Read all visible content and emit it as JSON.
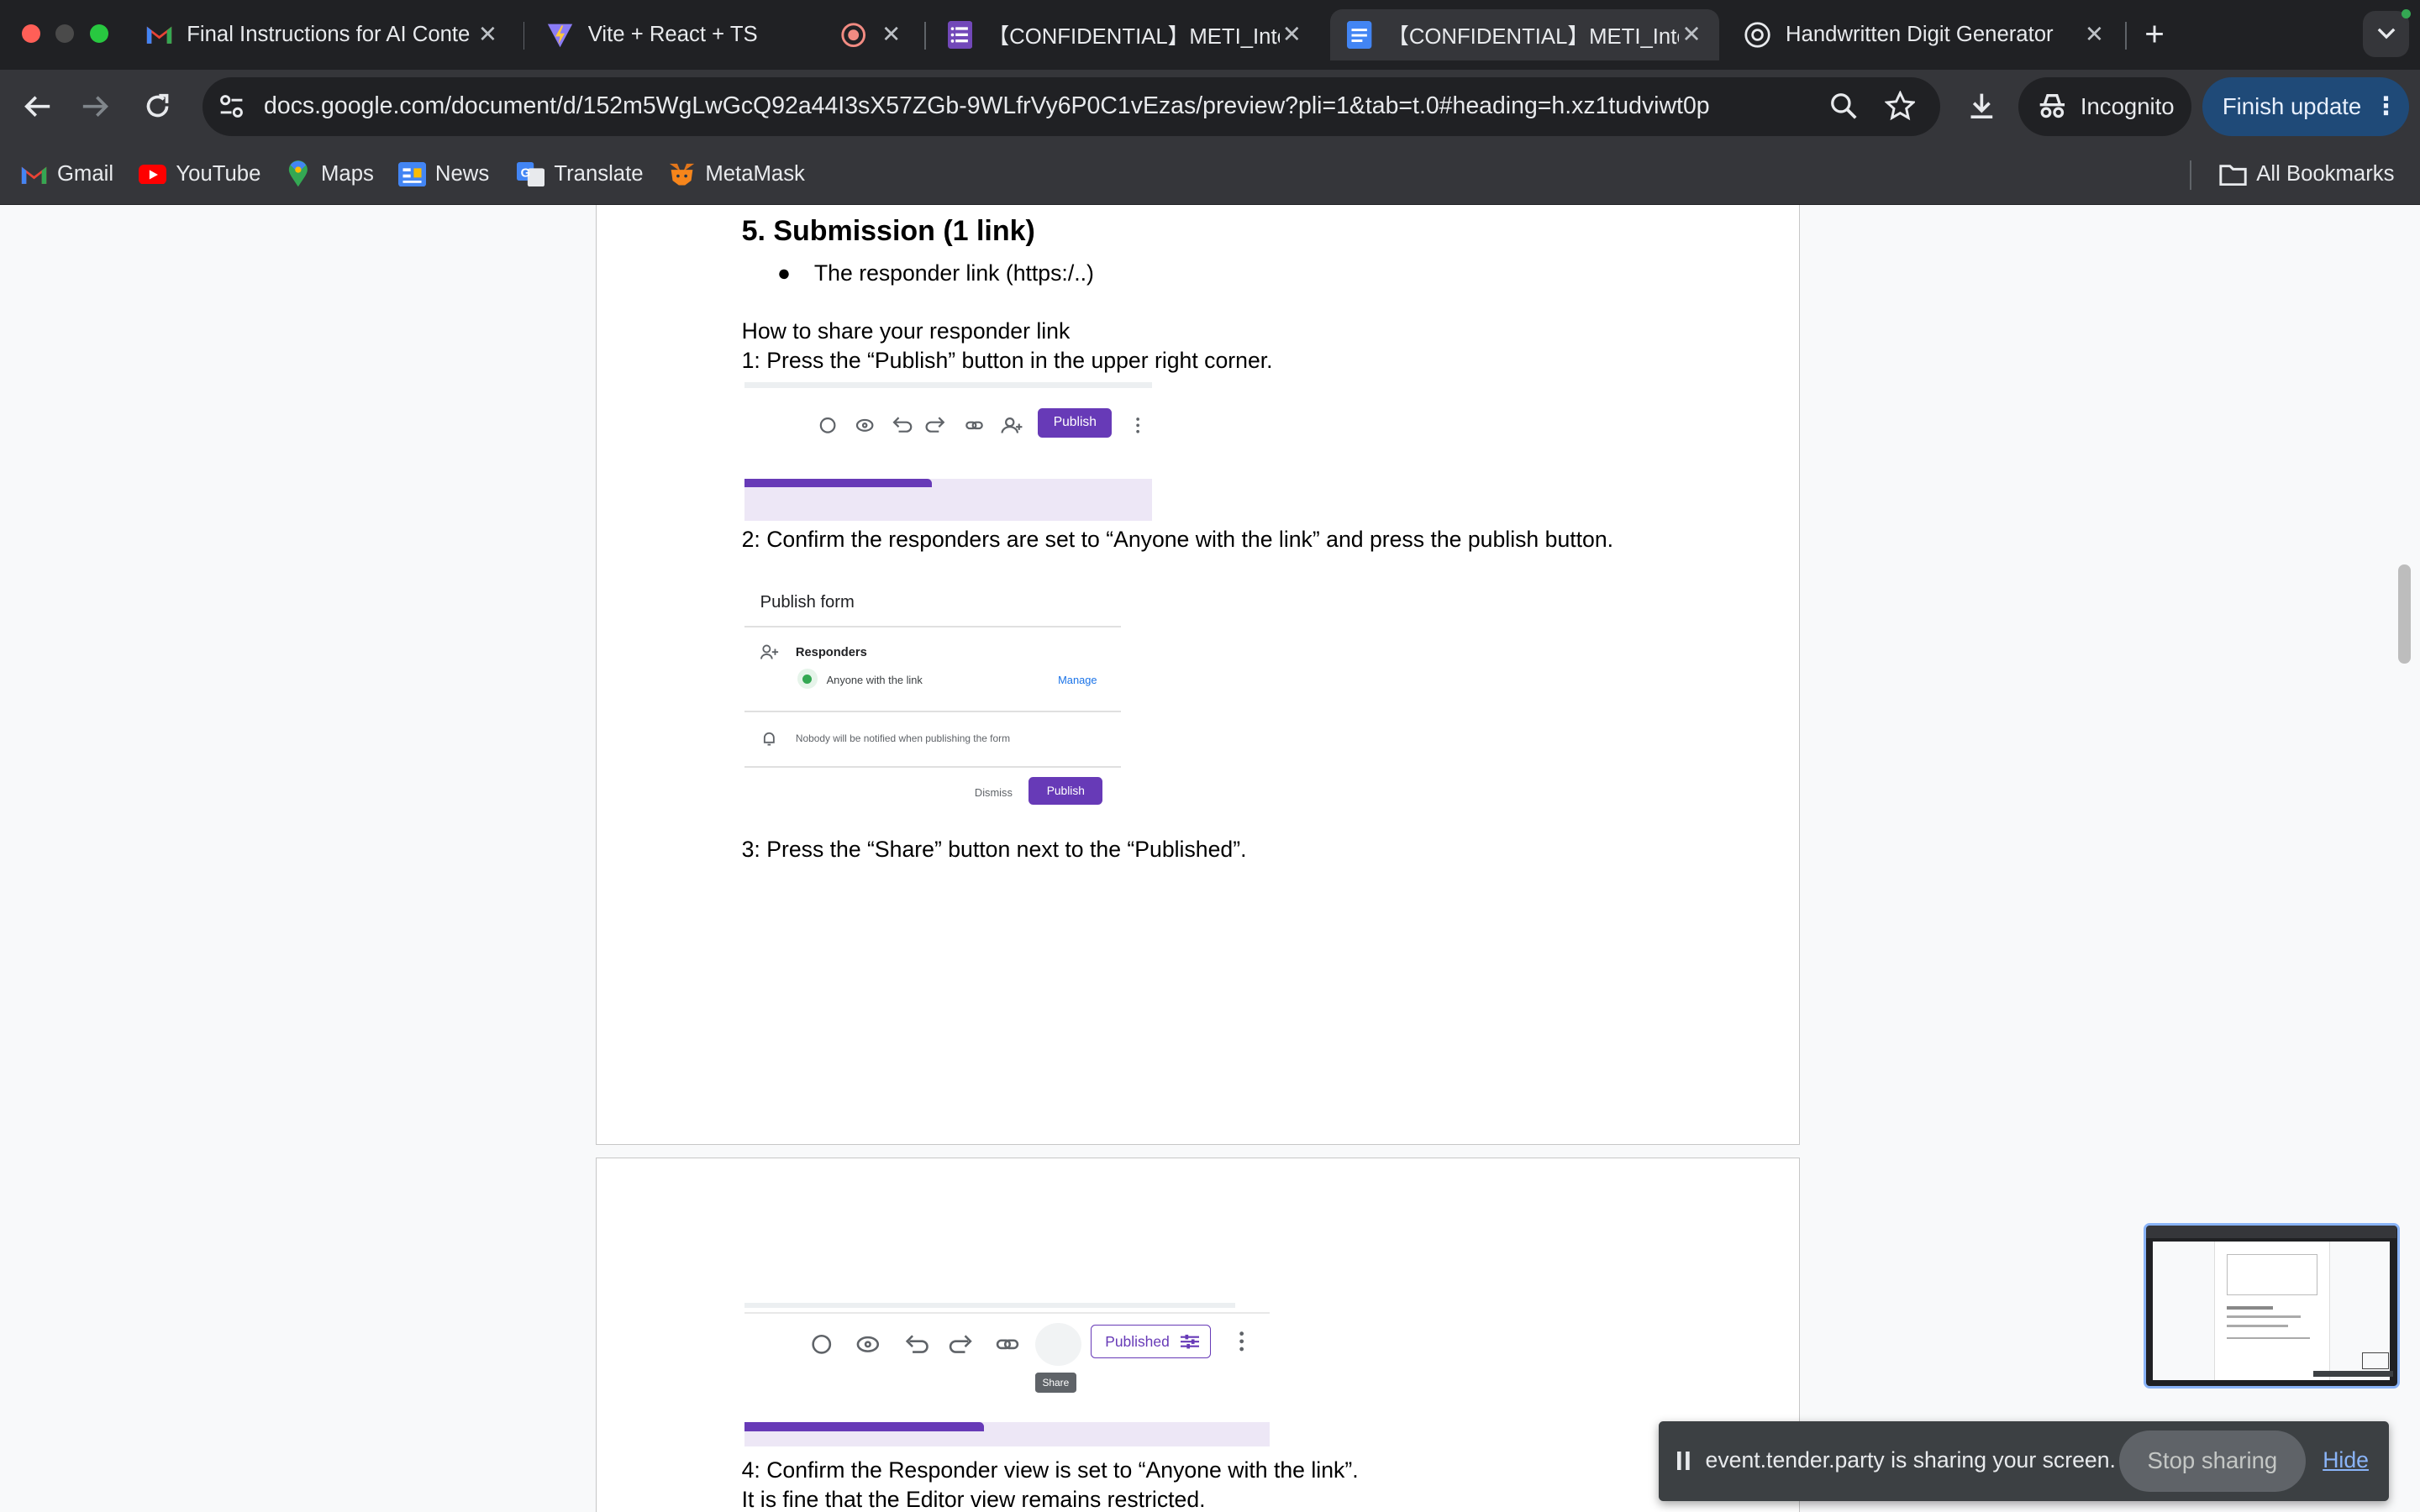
{
  "browser": {
    "tabs": [
      {
        "title": "Final Instructions for AI Conte",
        "favicon": "gmail-icon"
      },
      {
        "title": "Vite + React + TS",
        "favicon": "vite-icon"
      },
      {
        "title": "",
        "favicon": "recording-icon"
      },
      {
        "title": "【CONFIDENTIAL】METI_Inte",
        "favicon": "forms-icon"
      },
      {
        "title": "【CONFIDENTIAL】METI_Inte",
        "favicon": "docs-icon"
      },
      {
        "title": "Handwritten Digit Generator",
        "favicon": "openai-icon"
      }
    ],
    "url": "docs.google.com/document/d/152m5WgLwGcQ92a44I3sX57ZGb-9WLfrVy6P0C1vEzas/preview?pli=1&tab=t.0#heading=h.xz1tudviwt0p",
    "incognito_label": "Incognito",
    "finish_update_label": "Finish update",
    "bookmarks": [
      {
        "label": "Gmail",
        "icon": "gmail-icon"
      },
      {
        "label": "YouTube",
        "icon": "youtube-icon"
      },
      {
        "label": "Maps",
        "icon": "maps-icon"
      },
      {
        "label": "News",
        "icon": "news-icon"
      },
      {
        "label": "Translate",
        "icon": "translate-icon"
      },
      {
        "label": "MetaMask",
        "icon": "metamask-icon"
      }
    ],
    "all_bookmarks_label": "All Bookmarks"
  },
  "doc": {
    "section_heading": "5. Submission (1 link)",
    "bullet": "The responder link (https:/..)",
    "how_to": "How to share your responder link",
    "step1": "1: Press the “Publish” button in the upper right corner.",
    "step2": "2: Confirm the responders are set to “Anyone with the link” and press the publish button.",
    "step3": "3: Press the “Share” button next to the “Published”.",
    "step4": "4: Confirm the Responder view is set to “Anyone with the link”.",
    "step4b": "It is fine that the Editor view remains restricted."
  },
  "screenshot1": {
    "publish_button": "Publish"
  },
  "screenshot2": {
    "title": "Publish form",
    "responders_label": "Responders",
    "anyone_label": "Anyone with the link",
    "manage_label": "Manage",
    "notify_text": "Nobody will be notified when publishing the form",
    "dismiss_label": "Dismiss",
    "publish_label": "Publish"
  },
  "screenshot3": {
    "published_label": "Published",
    "share_tooltip": "Share"
  },
  "sharing": {
    "message": "event.tender.party is sharing your screen.",
    "stop_label": "Stop sharing",
    "hide_label": "Hide"
  },
  "colors": {
    "forms_purple": "#673ab7",
    "chrome_dark": "#202124",
    "chrome_toolbar": "#35363a"
  }
}
